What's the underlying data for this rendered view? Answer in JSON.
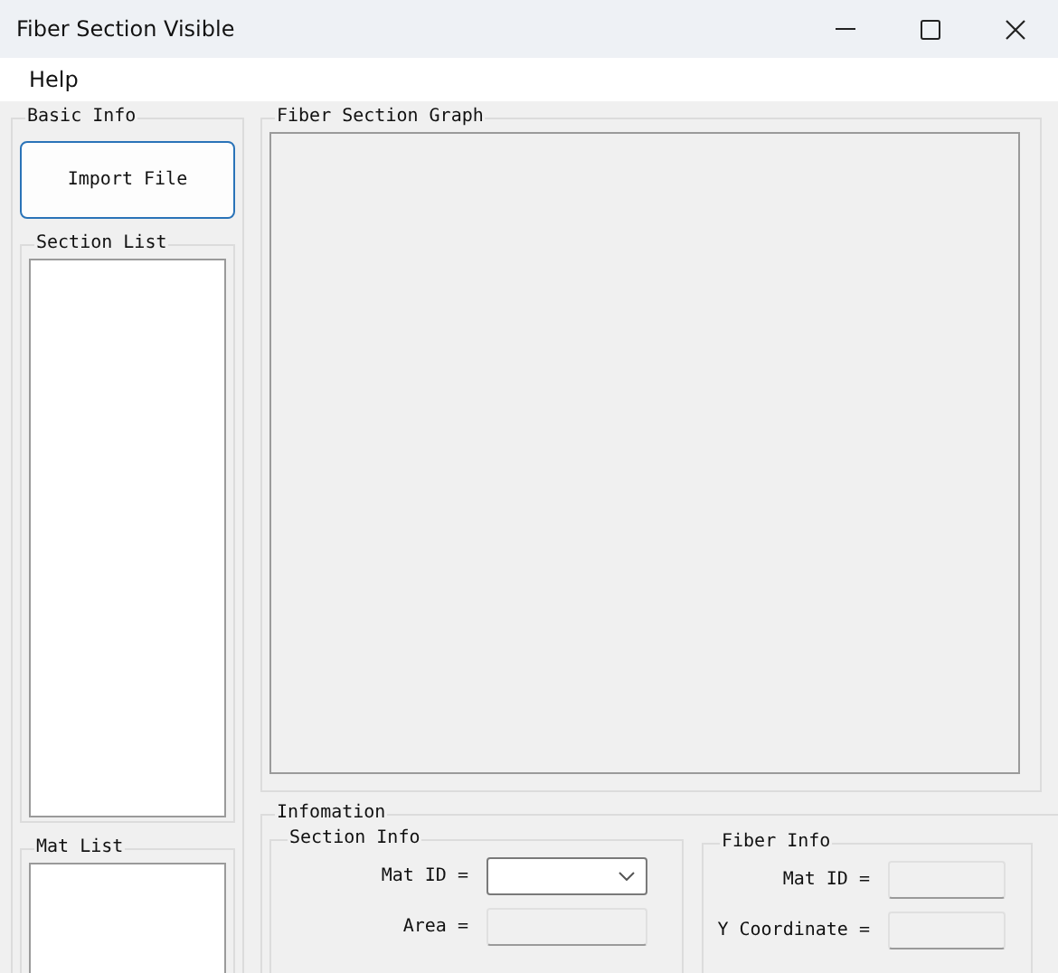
{
  "window": {
    "title": "Fiber Section Visible"
  },
  "menu": [
    "Help"
  ],
  "basic_info": {
    "title": "Basic Info",
    "import_button": "Import File",
    "section_list": {
      "title": "Section List"
    },
    "mat_list": {
      "title": "Mat List"
    }
  },
  "graph": {
    "title": "Fiber Section Graph"
  },
  "information": {
    "title": "Infomation",
    "section_info": {
      "title": "Section Info",
      "fields": [
        {
          "label": "Mat ID =",
          "kind": "dropdown",
          "disabled": false
        },
        {
          "label": "Area =",
          "kind": "text",
          "disabled": true
        }
      ]
    },
    "fiber_info": {
      "title": "Fiber Info",
      "fields": [
        {
          "label": "Mat ID =",
          "kind": "text",
          "disabled": true
        },
        {
          "label": "Y Coordinate =",
          "kind": "text",
          "disabled": true
        }
      ]
    }
  }
}
